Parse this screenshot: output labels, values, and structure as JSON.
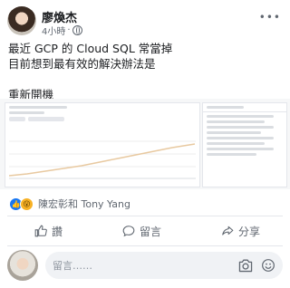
{
  "author": {
    "name": "廖煥杰"
  },
  "post": {
    "time": "4小時",
    "privacy_icon": "globe-icon",
    "more_icon": "more-icon",
    "text": "最近 GCP 的 Cloud SQL 常當掉\n目前想到最有效的解決辦法是\n\n重新開機"
  },
  "reactions": {
    "names": "陳宏彰和 Tony Yang",
    "types": [
      "like",
      "wow"
    ]
  },
  "actions": {
    "like_label": "讚",
    "comment_label": "留言",
    "share_label": "分享"
  },
  "comment": {
    "placeholder": "留言……"
  },
  "colors": {
    "accent": "#1877f2",
    "text": "#1c1e21",
    "secondary": "#606770"
  }
}
